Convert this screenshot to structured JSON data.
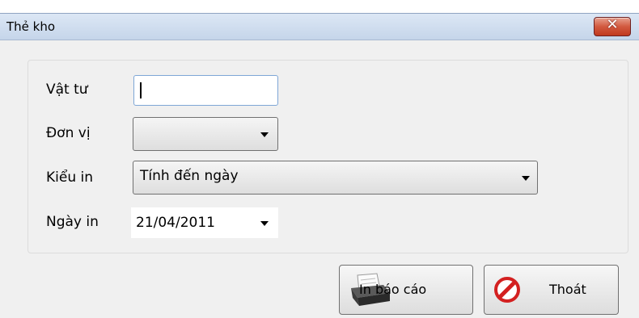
{
  "window": {
    "title": "Thẻ kho",
    "close_glyph": "✕"
  },
  "form": {
    "vat_tu": {
      "label": "Vật tư",
      "value": ""
    },
    "don_vi": {
      "label": "Đơn vị",
      "value": ""
    },
    "kieu_in": {
      "label": "Kiểu in",
      "value": "Tính đến ngày"
    },
    "ngay_in": {
      "label": "Ngày in",
      "value": "21/04/2011"
    }
  },
  "buttons": {
    "print_label": "In báo cáo",
    "exit_label": "Thoát"
  },
  "icons": {
    "print": "printer-icon",
    "exit": "stop-icon",
    "close": "close-icon",
    "dropdown": "chevron-down-icon"
  },
  "colors": {
    "close_button": "#c0391f",
    "textbox_border": "#7ea6d6",
    "stop_icon": "#d32020"
  }
}
